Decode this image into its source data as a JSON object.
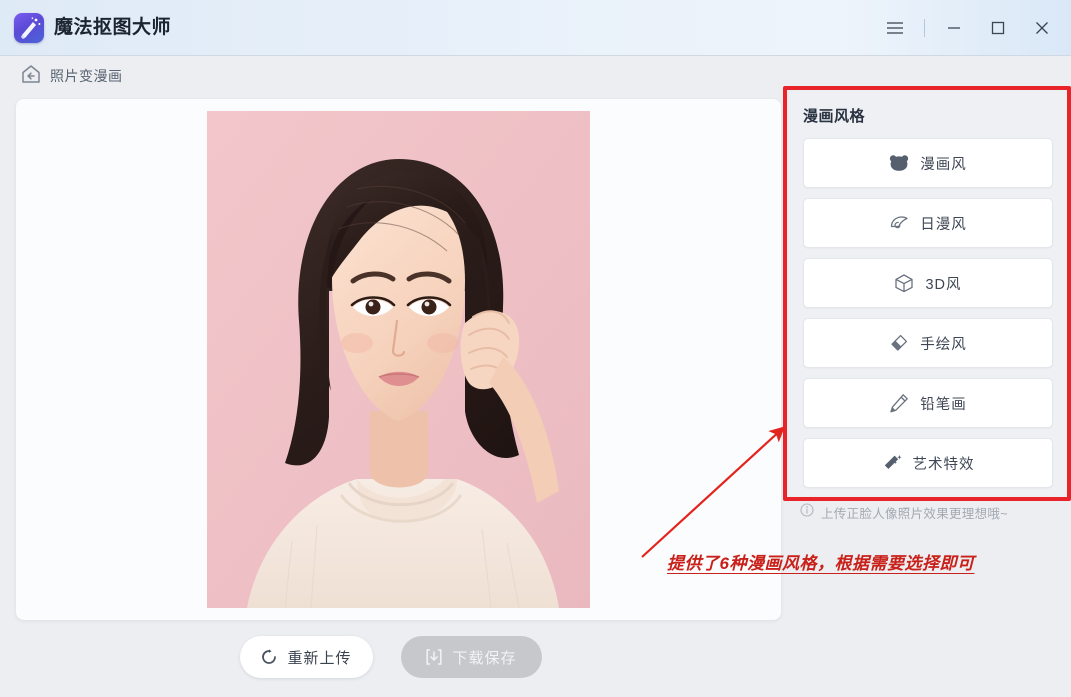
{
  "window": {
    "app_title": "魔法抠图大师",
    "logo_icon": "magic-wand-logo",
    "controls": [
      {
        "name": "menu",
        "icon": "hamburger-menu-icon"
      },
      {
        "name": "minimize",
        "icon": "minimize-icon"
      },
      {
        "name": "maximize",
        "icon": "maximize-icon"
      },
      {
        "name": "close",
        "icon": "close-icon"
      }
    ]
  },
  "breadcrumb": {
    "icon": "home-back-icon",
    "label": "照片变漫画"
  },
  "canvas": {
    "photo_alt": "portrait-photo-young-woman-pink-background"
  },
  "style_panel": {
    "title": "漫画风格",
    "items": [
      {
        "label": "漫画风",
        "icon": "bear-head-icon"
      },
      {
        "label": "日漫风",
        "icon": "konoha-leaf-icon"
      },
      {
        "label": "3D风",
        "icon": "cube-icon"
      },
      {
        "label": "手绘风",
        "icon": "eraser-icon"
      },
      {
        "label": "铅笔画",
        "icon": "pencil-icon"
      },
      {
        "label": "艺术特效",
        "icon": "magic-wand-icon"
      }
    ]
  },
  "hint": {
    "icon": "info-circle-icon",
    "text": "上传正脸人像照片效果更理想哦~"
  },
  "annotation": {
    "text": "提供了6种漫画风格，根据需要选择即可",
    "color": "#c9201a",
    "highlight_color": "#e8232a",
    "arrow": "red-arrow-pointing-up-right"
  },
  "footer": {
    "reupload": {
      "label": "重新上传",
      "icon": "refresh-icon"
    },
    "download": {
      "label": "下载保存",
      "icon": "download-icon",
      "state": "disabled"
    }
  },
  "colors": {
    "titlebar": "#e3edf9",
    "page_background": "#eceef1",
    "card_background": "#fbfcfd",
    "panel_background": "#eef0f3",
    "accent_red": "#e8232a",
    "logo_purple": "#5b4bd6"
  }
}
